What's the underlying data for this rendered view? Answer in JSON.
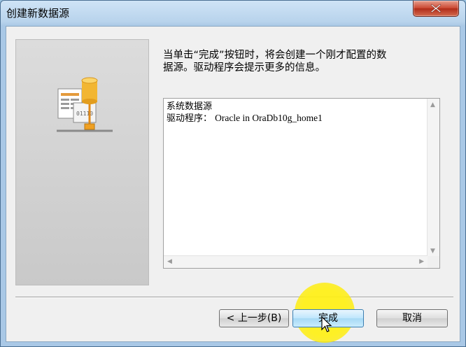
{
  "window": {
    "title": "创建新数据源"
  },
  "description": {
    "line1": "当单击“完成”按钮时，将会创建一个刚才配置的数",
    "line2": "据源。驱动程序会提示更多的信息。"
  },
  "listbox": {
    "line1": "系统数据源",
    "driver_label": "驱动程序：",
    "driver_value": "Oracle in OraDb10g_home1"
  },
  "buttons": {
    "back": "< 上一步(B)",
    "finish": "完成",
    "cancel": "取消"
  },
  "colors": {
    "highlight": "#ffee00",
    "title_close": "#c9452f"
  },
  "icons": {
    "wizard_image": "database-server-icon",
    "close": "close-icon",
    "cursor": "mouse-pointer-icon"
  }
}
